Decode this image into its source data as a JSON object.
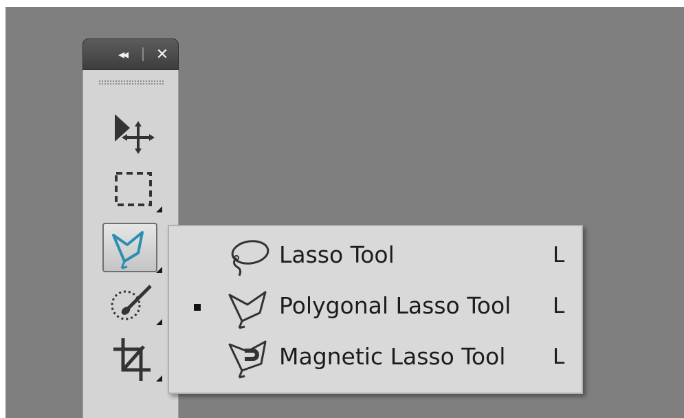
{
  "toolbar": {
    "header": {
      "collapse_icon": "double-chevron-left-icon",
      "collapse_label": "◂◂",
      "close_icon": "close-icon",
      "close_label": "✕"
    },
    "tools": [
      {
        "id": "move",
        "icon": "move-tool-icon",
        "selected": false
      },
      {
        "id": "marquee",
        "icon": "rectangular-marquee-icon",
        "selected": false
      },
      {
        "id": "lasso",
        "icon": "polygonal-lasso-icon",
        "selected": true
      },
      {
        "id": "quick-selection",
        "icon": "quick-selection-icon",
        "selected": false
      },
      {
        "id": "crop",
        "icon": "crop-icon",
        "selected": false
      }
    ],
    "accent_color": "#2a8fb0"
  },
  "flyout": {
    "items": [
      {
        "label": "Lasso Tool",
        "shortcut": "L",
        "icon": "lasso-icon",
        "active": false
      },
      {
        "label": "Polygonal Lasso Tool",
        "shortcut": "L",
        "icon": "polygonal-lasso-icon",
        "active": true
      },
      {
        "label": "Magnetic Lasso Tool",
        "shortcut": "L",
        "icon": "magnetic-lasso-icon",
        "active": false
      }
    ]
  }
}
